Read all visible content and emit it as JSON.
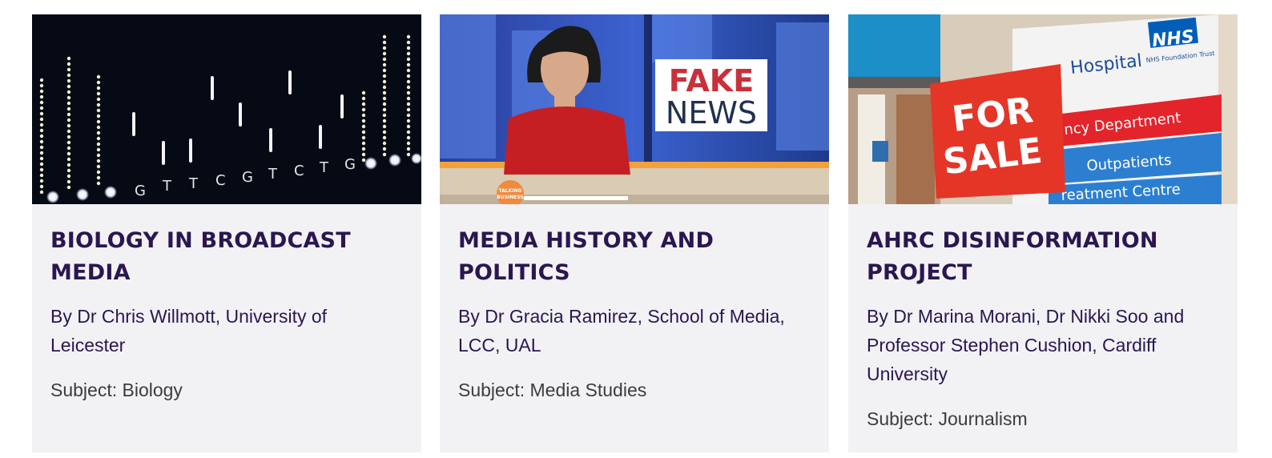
{
  "cards": [
    {
      "image_alt": "DNA sequence light bars",
      "image_text": [
        "G",
        "T",
        "T",
        "C",
        "G",
        "T",
        "C",
        "T",
        "G"
      ],
      "title": "BIOLOGY IN BROADCAST MEDIA",
      "byline": "By Dr Chris Willmott, University of Leicester",
      "subject": "Subject: Biology"
    },
    {
      "image_alt": "News presenter with fake news graphic",
      "image_text": [
        "FAKE",
        "NEWS",
        "TALKING",
        "BUSINESS"
      ],
      "title": "MEDIA HISTORY AND POLITICS",
      "byline": "By Dr Gracia Ramirez, School of Media, LCC, UAL",
      "subject": "Subject: Media Studies"
    },
    {
      "image_alt": "Hospital sign with for sale board",
      "image_text": [
        "FOR",
        "SALE",
        "Hospital",
        "NHS",
        "NHS Foundation Trust",
        "ncy Department",
        "Outpatients",
        "reatment Centre"
      ],
      "title": "AHRC DISINFORMATION PROJECT",
      "byline": "By Dr Marina Morani, Dr Nikki Soo and Professor Stephen Cushion, Cardiff University",
      "subject": "Subject: Journalism"
    }
  ],
  "colors": {
    "card_bg": "#f2f2f5",
    "title": "#2b1650",
    "byline": "#2b1650",
    "subject": "#3c3c3c",
    "nhs_blue": "#005eb8",
    "sale_red": "#e53527"
  }
}
